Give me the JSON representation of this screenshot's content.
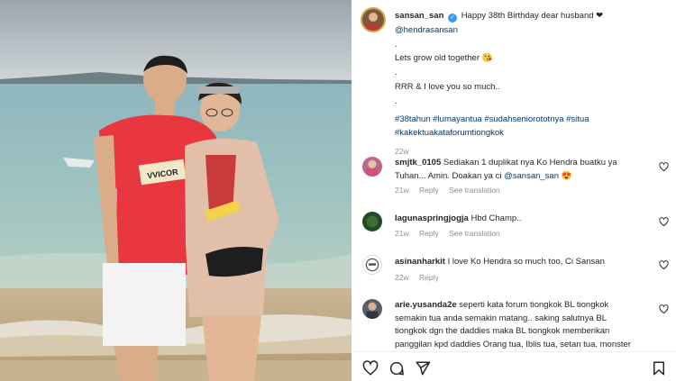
{
  "post": {
    "author": "sansan_san",
    "caption_lines": [
      "Happy 38th Birthday dear husband ❤",
      "@hendrasansan",
      ".",
      "Lets grow old together 😘",
      ".",
      "RRR & I love you so much..",
      ".",
      "#38tahun #lumayantua #sudahseniorototnya #situa",
      "#kakektuakataforumtiongkok"
    ],
    "time": "22w"
  },
  "comments": [
    {
      "user": "smjtk_0105",
      "text_line1": "Sediakan 1 duplikat nya Ko Hendra buatku ya",
      "text_line2_pre": "Tuhan... Amin. Doakan ya ci ",
      "mention": "@sansan_san",
      "text_line2_post": " 😍",
      "time": "21w",
      "reply": "Reply",
      "translate": "See translation"
    },
    {
      "user": "lagunaspringjogja",
      "text": "Hbd Champ..",
      "time": "21w",
      "reply": "Reply",
      "translate": "See translation"
    },
    {
      "user": "asinanharkit",
      "text": "I love Ko Hendra so much too, Ci Sansan",
      "time": "22w",
      "reply": "Reply"
    },
    {
      "user": "arie.yusanda2e",
      "lines": [
        "seperti kata forum tiongkok BL tiongkok",
        "semakin tua anda semakin matang.. saking salutnya BL",
        "tiongkok dgn the daddies maka BL tiongkok memberikan",
        "panggilan kpd daddies Orang tua, Iblis tua, setan tua, monster"
      ]
    }
  ],
  "photo": {
    "shirt_text": "VVICOR"
  },
  "icons": {
    "like": "heart-icon",
    "comment": "comment-icon",
    "share": "share-icon",
    "save": "bookmark-icon"
  },
  "colors": {
    "link": "#00376b",
    "meta": "#8e8e8e",
    "verified": "#3897f0"
  }
}
